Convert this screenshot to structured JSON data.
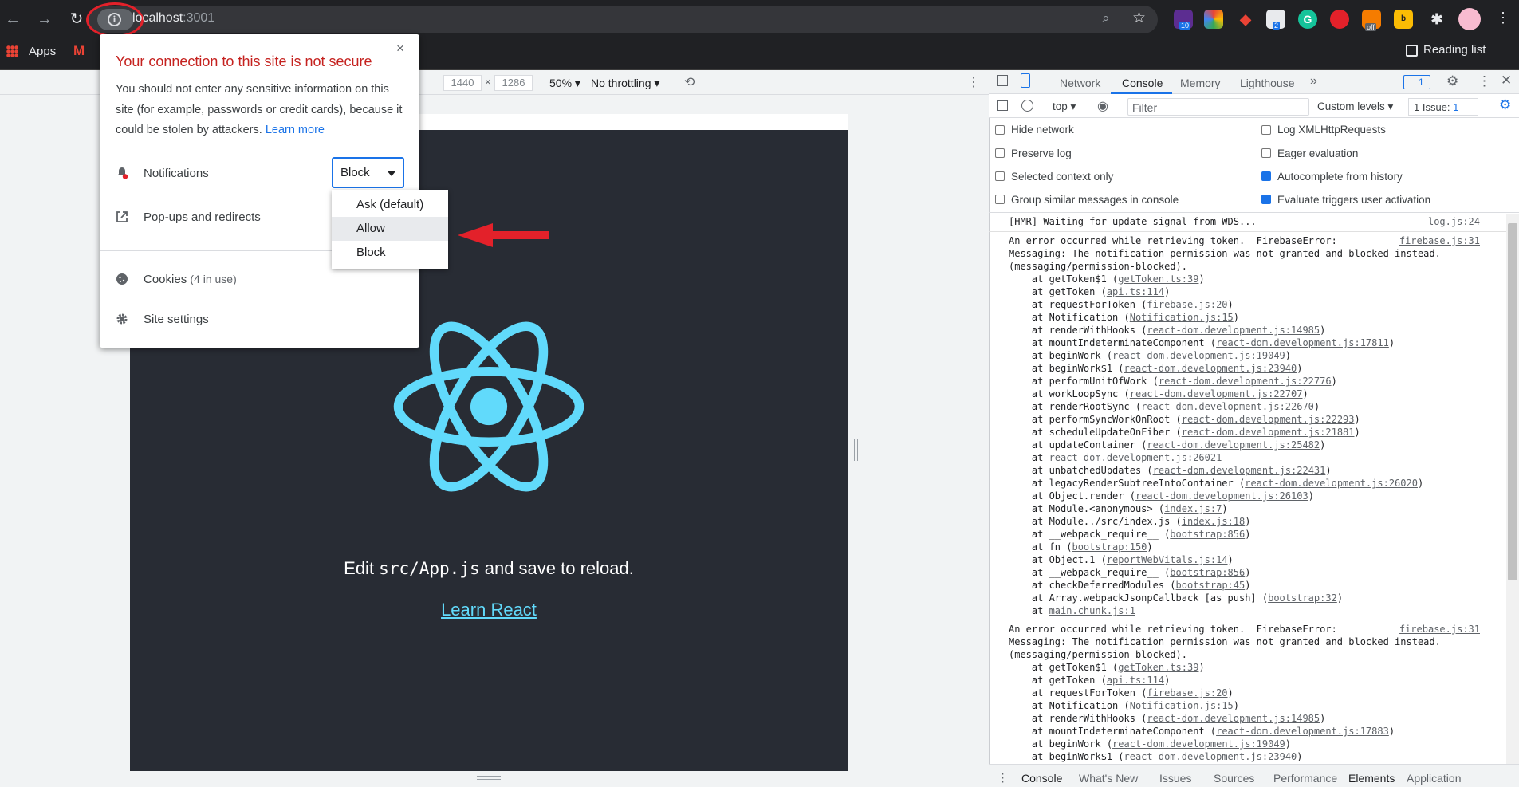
{
  "browser": {
    "url_host": "localhost",
    "url_port": ":3001",
    "bookmarks": {
      "apps": "Apps"
    },
    "reading_list": "Reading list",
    "extension_badges": [
      "10",
      "2",
      "off"
    ]
  },
  "device_toolbar": {
    "width": "1440",
    "x": "×",
    "height": "1286",
    "zoom": "50%",
    "throttling": "No throttling"
  },
  "page": {
    "edit_prefix": "Edit ",
    "edit_code": "src/App.js",
    "edit_suffix": " and save to reload.",
    "learn_link": "Learn React",
    "bg_color": "#282c34",
    "accent": "#61dafb"
  },
  "site_popup": {
    "title": "Your connection to this site is not secure",
    "body": "You should not enter any sensitive information on this site (for example, passwords or credit cards), because it could be stolen by attackers.",
    "learn_more": "Learn more",
    "notifications_label": "Notifications",
    "notifications_value": "Block",
    "popups_label": "Pop-ups and redirects",
    "cookies_label": "Cookies",
    "cookies_count": "(4 in use)",
    "site_settings": "Site settings",
    "close": "×",
    "dropdown_options": [
      "Ask (default)",
      "Allow",
      "Block"
    ],
    "highlighted_option": "Allow"
  },
  "devtools": {
    "tabs": [
      "Network",
      "Console",
      "Memory",
      "Lighthouse"
    ],
    "active_tab": "Console",
    "more_tabs": "»",
    "badge_count": "1",
    "context": "top",
    "filter_placeholder": "Filter",
    "levels": "Custom levels",
    "issues": "1 Issue:",
    "issues_count": "1",
    "settings_left": [
      "Hide network",
      "Preserve log",
      "Selected context only",
      "Group similar messages in console"
    ],
    "settings_right": [
      "Log XMLHttpRequests",
      "Eager evaluation",
      "Autocomplete from history",
      "Evaluate triggers user activation"
    ],
    "settings_right_checked": [
      false,
      false,
      true,
      true
    ],
    "drawer_tabs": [
      "Console",
      "What's New",
      "Issues",
      "Sources",
      "Performance",
      "Elements",
      "Application"
    ]
  },
  "console": {
    "hmr": "[HMR] Waiting for update signal from WDS...",
    "hmr_src": "log.js:24",
    "error1_lines": [
      "An error occurred while retrieving token.  FirebaseError:",
      "Messaging: The notification permission was not granted and blocked instead.",
      "(messaging/permission-blocked)."
    ],
    "error_src": "firebase.js:31",
    "stack1": [
      [
        "    at getToken$1 (",
        "getToken.ts:39",
        ")"
      ],
      [
        "    at getToken (",
        "api.ts:114",
        ")"
      ],
      [
        "    at requestForToken (",
        "firebase.js:20",
        ")"
      ],
      [
        "    at Notification (",
        "Notification.js:15",
        ")"
      ],
      [
        "    at renderWithHooks (",
        "react-dom.development.js:14985",
        ")"
      ],
      [
        "    at mountIndeterminateComponent (",
        "react-dom.development.js:17811",
        ")"
      ],
      [
        "    at beginWork (",
        "react-dom.development.js:19049",
        ")"
      ],
      [
        "    at beginWork$1 (",
        "react-dom.development.js:23940",
        ")"
      ],
      [
        "    at performUnitOfWork (",
        "react-dom.development.js:22776",
        ")"
      ],
      [
        "    at workLoopSync (",
        "react-dom.development.js:22707",
        ")"
      ],
      [
        "    at renderRootSync (",
        "react-dom.development.js:22670",
        ")"
      ],
      [
        "    at performSyncWorkOnRoot (",
        "react-dom.development.js:22293",
        ")"
      ],
      [
        "    at scheduleUpdateOnFiber (",
        "react-dom.development.js:21881",
        ")"
      ],
      [
        "    at updateContainer (",
        "react-dom.development.js:25482",
        ")"
      ],
      [
        "    at ",
        "react-dom.development.js:26021",
        ""
      ],
      [
        "    at unbatchedUpdates (",
        "react-dom.development.js:22431",
        ")"
      ],
      [
        "    at legacyRenderSubtreeIntoContainer (",
        "react-dom.development.js:26020",
        ")"
      ],
      [
        "    at Object.render (",
        "react-dom.development.js:26103",
        ")"
      ],
      [
        "    at Module.<anonymous> (",
        "index.js:7",
        ")"
      ],
      [
        "    at Module../src/index.js (",
        "index.js:18",
        ")"
      ],
      [
        "    at __webpack_require__ (",
        "bootstrap:856",
        ")"
      ],
      [
        "    at fn (",
        "bootstrap:150",
        ")"
      ],
      [
        "    at Object.1 (",
        "reportWebVitals.js:14",
        ")"
      ],
      [
        "    at __webpack_require__ (",
        "bootstrap:856",
        ")"
      ],
      [
        "    at checkDeferredModules (",
        "bootstrap:45",
        ")"
      ],
      [
        "    at Array.webpackJsonpCallback [as push] (",
        "bootstrap:32",
        ")"
      ],
      [
        "    at ",
        "main.chunk.js:1",
        ""
      ]
    ],
    "stack2": [
      [
        "    at getToken$1 (",
        "getToken.ts:39",
        ")"
      ],
      [
        "    at getToken (",
        "api.ts:114",
        ")"
      ],
      [
        "    at requestForToken (",
        "firebase.js:20",
        ")"
      ],
      [
        "    at Notification (",
        "Notification.js:15",
        ")"
      ],
      [
        "    at renderWithHooks (",
        "react-dom.development.js:14985",
        ")"
      ],
      [
        "    at mountIndeterminateComponent (",
        "react-dom.development.js:17883",
        ")"
      ],
      [
        "    at beginWork (",
        "react-dom.development.js:19049",
        ")"
      ],
      [
        "    at beginWork$1 (",
        "react-dom.development.js:23940",
        ")"
      ]
    ]
  }
}
